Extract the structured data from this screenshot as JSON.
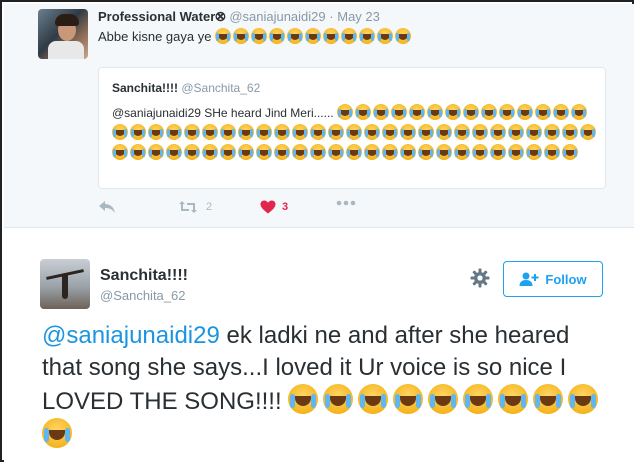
{
  "quoted_tweet": {
    "author_name": "Professional Water⮿",
    "author_handle": "@saniajunaidi29",
    "separator": "·",
    "date": "May 23",
    "text": "Abbe kisne gaya ye",
    "emoji_count": 11,
    "emoji_icon": "loudly-crying-face-emoji",
    "quote": {
      "author_name": "Sanchita!!!!",
      "author_handle": "@Sanchita_62",
      "text": "@saniajunaidi29  SHe heard Jind Meri......",
      "emoji_icon": "loudly-crying-face-emoji",
      "emoji_count": 67
    },
    "actions": {
      "retweet_count": "2",
      "like_count": "3"
    }
  },
  "main_tweet": {
    "author_name": "Sanchita!!!!",
    "author_handle": "@Sanchita_62",
    "follow_label": "Follow",
    "mention": "@saniajunaidi29",
    "text": "  ek ladki ne and after she heared that song she says...I loved it Ur voice is so nice I LOVED THE SONG!!!! ",
    "emoji_icon": "loudly-crying-face-emoji",
    "emoji_count": 10
  },
  "colors": {
    "link": "#1b95e0",
    "follow": "#1da1f2",
    "like": "#e2264d",
    "muted": "#8899a6"
  }
}
